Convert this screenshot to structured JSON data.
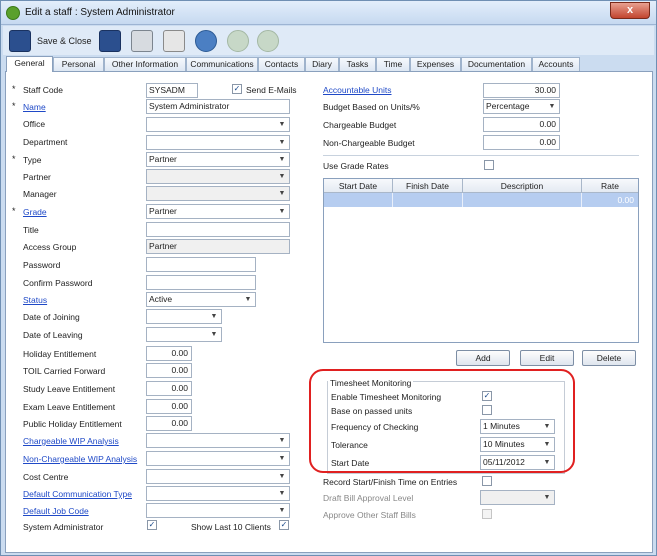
{
  "window": {
    "title": "Edit a staff : System Administrator",
    "close_label": "x"
  },
  "toolbar": {
    "save_close_label": "Save & Close"
  },
  "tabs": [
    "General",
    "Personal",
    "Other Information",
    "Communications",
    "Contacts",
    "Diary",
    "Tasks",
    "Time",
    "Expenses",
    "Documentation",
    "Accounts"
  ],
  "left": {
    "staff_code": {
      "label": "Staff Code",
      "value": "SYSADM"
    },
    "send_emails": {
      "label": "Send E-Mails",
      "checked": true
    },
    "name": {
      "label": "Name",
      "value": "System Administrator"
    },
    "office": {
      "label": "Office",
      "value": ""
    },
    "department": {
      "label": "Department",
      "value": ""
    },
    "type": {
      "label": "Type",
      "value": "Partner"
    },
    "partner": {
      "label": "Partner",
      "value": ""
    },
    "manager": {
      "label": "Manager",
      "value": ""
    },
    "grade": {
      "label": "Grade",
      "value": "Partner"
    },
    "title": {
      "label": "Title",
      "value": ""
    },
    "access_group": {
      "label": "Access Group",
      "value": "Partner"
    },
    "password": {
      "label": "Password",
      "value": ""
    },
    "confirm_password": {
      "label": "Confirm Password",
      "value": ""
    },
    "status": {
      "label": "Status",
      "value": "Active"
    },
    "date_joining": {
      "label": "Date of Joining",
      "value": ""
    },
    "date_leaving": {
      "label": "Date of Leaving",
      "value": ""
    },
    "holiday_entitlement": {
      "label": "Holiday Entitlement",
      "value": "0.00"
    },
    "toil_carried": {
      "label": "TOIL Carried Forward",
      "value": "0.00"
    },
    "study_leave": {
      "label": "Study Leave Entitlement",
      "value": "0.00"
    },
    "exam_leave": {
      "label": "Exam Leave Entitlement",
      "value": "0.00"
    },
    "public_holiday": {
      "label": "Public Holiday Entitlement",
      "value": "0.00"
    },
    "chargeable_wip": {
      "label": "Chargeable WIP Analysis",
      "value": ""
    },
    "nonchargeable_wip": {
      "label": "Non-Chargeable WIP Analysis",
      "value": ""
    },
    "cost_centre": {
      "label": "Cost Centre",
      "value": ""
    },
    "default_comm_type": {
      "label": "Default Communication Type",
      "value": ""
    },
    "default_job_code": {
      "label": "Default Job Code",
      "value": ""
    },
    "system_admin": {
      "label": "System Administrator",
      "checked": true
    },
    "show_last_clients": {
      "label": "Show Last 10 Clients",
      "checked": true
    }
  },
  "right": {
    "accountable_units": {
      "label": "Accountable Units",
      "value": "30.00"
    },
    "budget_based_on": {
      "label": "Budget Based on Units/%",
      "value": "Percentage"
    },
    "chargeable_budget": {
      "label": "Chargeable Budget",
      "value": "0.00"
    },
    "nonchargeable_budget": {
      "label": "Non-Chargeable Budget",
      "value": "0.00"
    },
    "use_grade_rates": {
      "label": "Use Grade Rates",
      "checked": false
    },
    "grid": {
      "columns": [
        "Start Date",
        "Finish Date",
        "Description",
        "Rate"
      ],
      "rows": [
        [
          "",
          "",
          "",
          "0.00"
        ]
      ]
    },
    "buttons": {
      "add": "Add",
      "edit": "Edit",
      "delete": "Delete"
    },
    "timesheet": {
      "title": "Timesheet Monitoring",
      "enable": {
        "label": "Enable Timesheet Monitoring",
        "checked": true
      },
      "passed_units": {
        "label": "Base on passed units",
        "checked": false
      },
      "frequency": {
        "label": "Frequency of Checking",
        "value": "1 Minutes"
      },
      "tolerance": {
        "label": "Tolerance",
        "value": "10 Minutes"
      },
      "start_date": {
        "label": "Start Date",
        "value": "05/11/2012"
      }
    },
    "record_start_finish": {
      "label": "Record Start/Finish Time on Entries",
      "checked": false
    },
    "draft_bill_level": {
      "label": "Draft Bill Approval Level",
      "value": ""
    },
    "approve_other_bills": {
      "label": "Approve Other Staff Bills",
      "checked": false
    }
  },
  "colors": {
    "highlight": "#e02020",
    "link": "#1f49c7",
    "selected_row": "#b6cdf0"
  }
}
